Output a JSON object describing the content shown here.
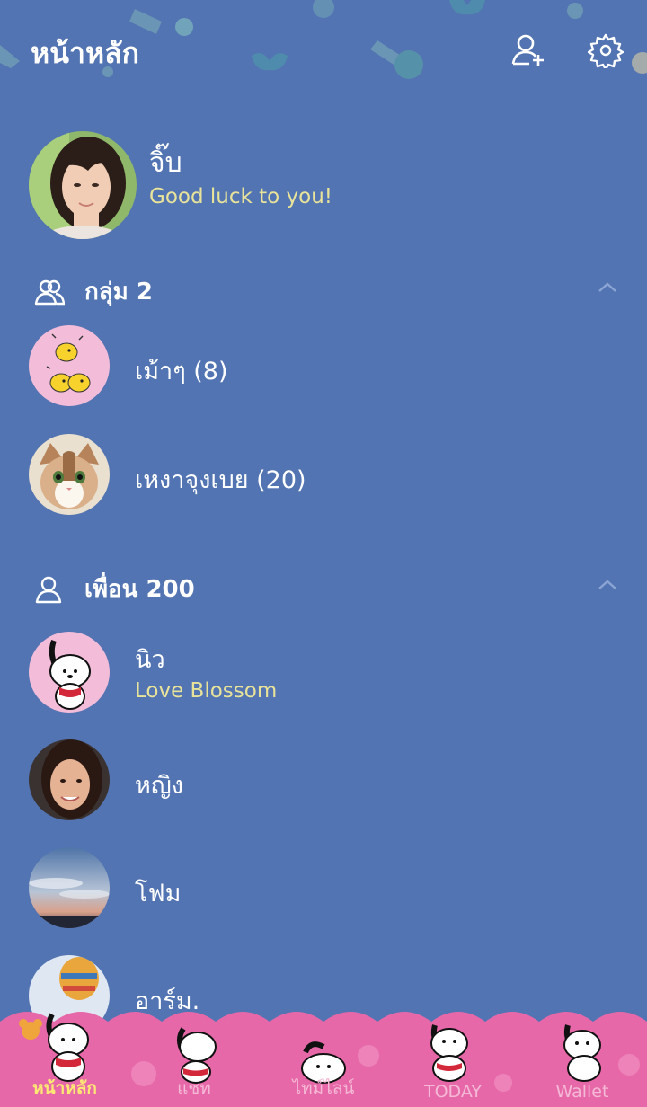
{
  "header": {
    "title": "หน้าหลัก",
    "add_friend_icon": "add-friend-icon",
    "settings_icon": "gear-icon"
  },
  "profile": {
    "name": "จิ๊บ",
    "status": "Good luck to you!"
  },
  "groups": {
    "title": "กลุ่ม 2",
    "items": [
      {
        "name": "เม้าๆ (8)"
      },
      {
        "name": "เหงาจุงเบย (20)"
      }
    ]
  },
  "friends": {
    "title": "เพื่อน 200",
    "items": [
      {
        "name": "นิว",
        "status": "Love Blossom"
      },
      {
        "name": "หญิง"
      },
      {
        "name": "โฟม"
      },
      {
        "name": "อาร์ม."
      }
    ]
  },
  "tabs": [
    {
      "label": "หน้าหลัก",
      "active": true
    },
    {
      "label": "แชท"
    },
    {
      "label": "ไทม์ไลน์"
    },
    {
      "label": "TODAY"
    },
    {
      "label": "Wallet"
    }
  ],
  "colors": {
    "background": "#5274b2",
    "status_text": "#e9e39a",
    "tabbar": "#e768a8",
    "active_tab": "#ffe873"
  }
}
